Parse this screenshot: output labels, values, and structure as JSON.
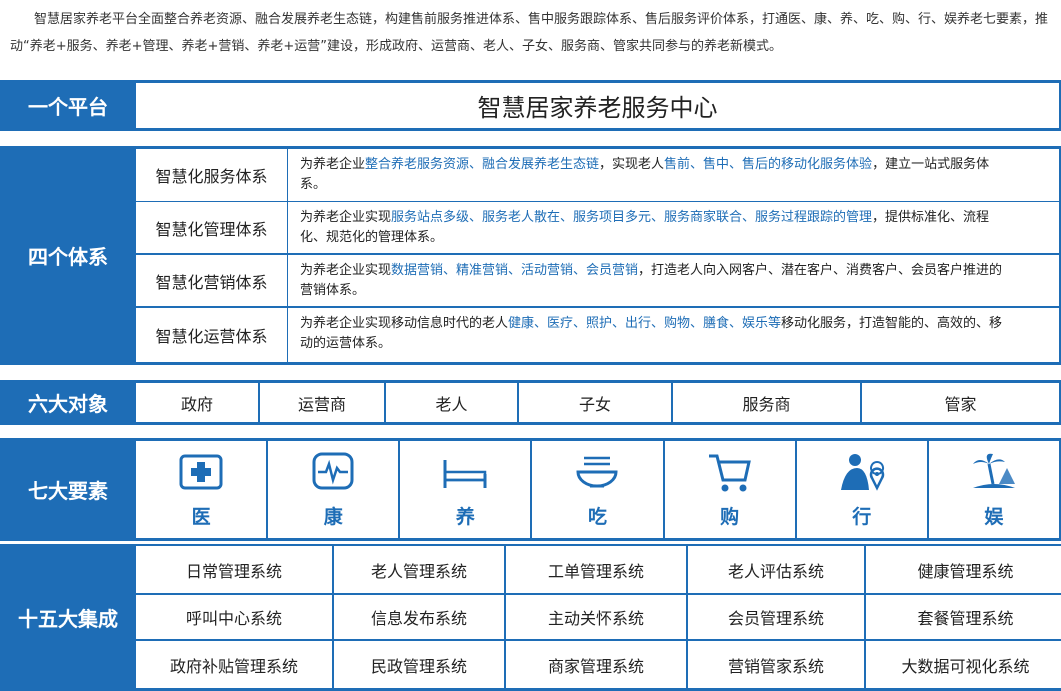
{
  "intro": {
    "part1": "智慧居家养老平台全面整合养老资源、融合发展养老生态链，构建售前服务推进体系、售中服务跟踪体系、售后服务评价体系，打通医、康、养、吃、购、行、娱养老七要素，推动“养老+服务、养老+管理、养老+营销、养老+运营”建设，形成政府、运营商、老人、子女、服务商、管家共同参与的养老新模式。"
  },
  "platform": {
    "label": "一个平台",
    "title": "智慧居家养老服务中心"
  },
  "systems": {
    "label": "四个体系",
    "items": [
      {
        "name": "智慧化服务体系",
        "segments": [
          {
            "t": "为养老企业",
            "hl": false
          },
          {
            "t": "整合养老服务资源、融合发展养老生态链",
            "hl": true
          },
          {
            "t": "，实现老人",
            "hl": false
          },
          {
            "t": "售前、售中、售后的移动化服务体验",
            "hl": true
          },
          {
            "t": "，建立一站式服务体系。",
            "hl": false
          }
        ]
      },
      {
        "name": "智慧化管理体系",
        "segments": [
          {
            "t": "为养老企业实现",
            "hl": false
          },
          {
            "t": "服务站点多级、服务老人散在、服务项目多元、服务商家联合、服务过程跟踪的管理",
            "hl": true
          },
          {
            "t": "，提供标准化、流程化、规范化的管理体系。",
            "hl": false
          }
        ]
      },
      {
        "name": "智慧化营销体系",
        "segments": [
          {
            "t": "为养老企业实现",
            "hl": false
          },
          {
            "t": "数据营销、精准营销、活动营销、会员营销",
            "hl": true
          },
          {
            "t": "，打造老人向入网客户、潜在客户、消费客户、会员客户推进的营销体系。",
            "hl": false
          }
        ]
      },
      {
        "name": "智慧化运营体系",
        "segments": [
          {
            "t": "为养老企业实现移动信息时代的老人",
            "hl": false
          },
          {
            "t": "健康、医疗、照护、出行、购物、膳食、娱乐等",
            "hl": true
          },
          {
            "t": "移动化服务，打造智能的、高效的、移动的运营体系。",
            "hl": false
          }
        ]
      }
    ]
  },
  "objects": {
    "label": "六大对象",
    "items": [
      "政府",
      "运营商",
      "老人",
      "子女",
      "服务商",
      "管家"
    ]
  },
  "elements": {
    "label": "七大要素",
    "items": [
      {
        "label": "医",
        "icon": "medical-kit-icon"
      },
      {
        "label": "康",
        "icon": "heartbeat-monitor-icon"
      },
      {
        "label": "养",
        "icon": "bed-icon"
      },
      {
        "label": "吃",
        "icon": "noodle-bowl-icon"
      },
      {
        "label": "购",
        "icon": "shopping-cart-icon"
      },
      {
        "label": "行",
        "icon": "traveler-location-icon"
      },
      {
        "label": "娱",
        "icon": "island-palm-icon"
      }
    ]
  },
  "integrations": {
    "label": "十五大集成",
    "items": [
      "日常管理系统",
      "老人管理系统",
      "工单管理系统",
      "老人评估系统",
      "健康管理系统",
      "呼叫中心系统",
      "信息发布系统",
      "主动关怀系统",
      "会员管理系统",
      "套餐管理系统",
      "政府补贴管理系统",
      "民政管理系统",
      "商家管理系统",
      "营销管家系统",
      "大数据可视化系统"
    ]
  },
  "colors": {
    "brand": "#1e6db6",
    "highlight": "#1e6db6"
  }
}
